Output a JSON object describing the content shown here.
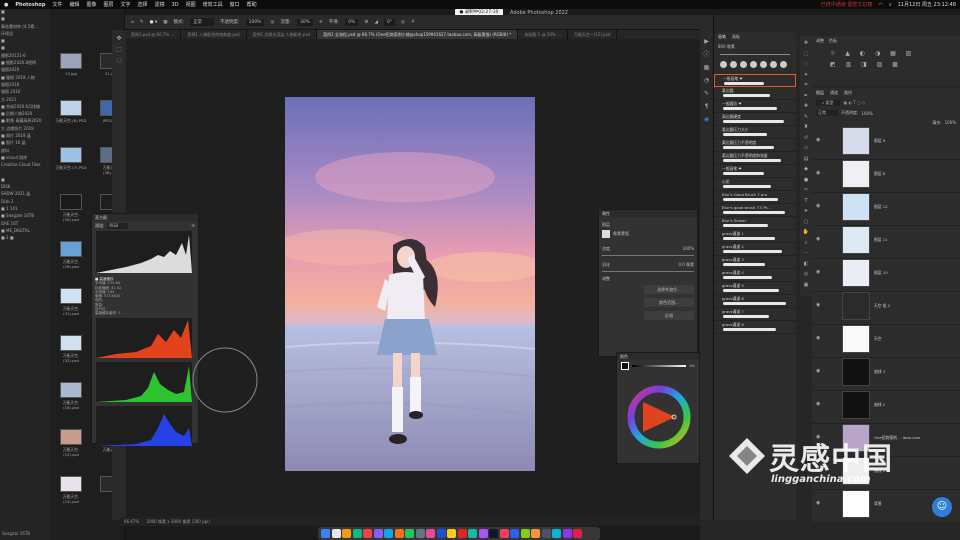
{
  "menubar": {
    "apple": "",
    "app": "Photoshop",
    "items": [
      "文件",
      "编辑",
      "图像",
      "图层",
      "文字",
      "选择",
      "滤镜",
      "3D",
      "视图",
      "增效工具",
      "窗口",
      "帮助"
    ],
    "status": "已修中通道 便签文幻丽",
    "datetime": "11月12日 周五 23:12:48"
  },
  "window": {
    "timer": "● 录制中02:27:30",
    "title": "Adobe Photoshop 2022"
  },
  "options": {
    "mode_label": "模式:",
    "mode_value": "正常",
    "opacity_label": "不透明度:",
    "opacity_value": "100%",
    "flow_label": "流量:",
    "flow_value": "30%",
    "smooth_label": "平滑:",
    "smooth_value": "0%",
    "angle_value": "0°"
  },
  "tabs": [
    "案例1.psd @ 66.7% ...",
    "案例1 人物配合的饱和度.psd",
    "案例1 边缘光渲染 人物配合.psd",
    "案例1 全流程.psd @ 66.7% (One招商案例小铺@shop159941627.taobao.com, 高级素描) (RGB/8) *",
    "未标题-1 @ 50% ...",
    "万能天空—(12).psd"
  ],
  "finder": {
    "sidebar": [
      "■",
      "■",
      "事务素材库 (4.5素...",
      "环境设",
      "■",
      "■",
      "摄影20121-6",
      "■ 摄影2020.8透明",
      "服图2020",
      "■ 服图 2018 人物",
      "服图2018",
      "服图 2016",
      "大 2021",
      "■ 合成2020.6月排输",
      "■ 后期人物2020",
      "■ 影像 青藏高原2020",
      "大 边缘照片 2019",
      "■ 照片 2018 晶",
      "■ 照片 16 晶",
      "度料",
      "■ icloud 照库",
      "Creative Cloud Files",
      "",
      "■",
      "DISK",
      "SHDW 2021 晶",
      "Disk 2",
      "■ 1 141",
      "■ Seagate 16TB",
      "GRE 16T",
      "■ ME_DIGITAL",
      "■ 2 ■"
    ],
    "files": [
      [
        "13.jpg",
        "21.jpg"
      ],
      [
        "万能天空-(8).PSD",
        "JPEG图片"
      ],
      [
        "万能天空-(7).PSD",
        "万能天空-(36).psd"
      ],
      [
        "万能天空-(30).psd",
        ""
      ],
      [
        "万能天空-(29).psd",
        "万能天空-"
      ],
      [
        "万能天空-(31).psd",
        "万能天空-"
      ],
      [
        "万能天空-(32).psd",
        "万能天空-"
      ],
      [
        "万能天空-(18).psd",
        "万能天空-"
      ],
      [
        "万能天空-(15).psd",
        "万能天空-"
      ],
      [
        "万能天空-(14).psd",
        ""
      ]
    ],
    "bottom": "Seagate 16TB"
  },
  "histogram": {
    "title": "直方图",
    "channel_label": "通道:",
    "channel_value": "RGB",
    "stats": [
      "平均值: 175.64",
      "标准偏差: 41.52",
      "中间值: 190",
      "像素: 5713400",
      "色阶:",
      "数量:",
      "百分位:",
      "高速缓存级别: 3"
    ],
    "tab": "■ 高速缓存"
  },
  "properties": {
    "title": "属性",
    "layer_label": "图层",
    "mask_label": "像素蒙版",
    "density_label": "浓度",
    "density_value": "100%",
    "feather_label": "羽化",
    "feather_value": "0.0 像素",
    "refine_label": "调整",
    "btn1": "选择并遮住...",
    "btn2": "颜色范围...",
    "btn3": "反相"
  },
  "color": {
    "title": "颜色",
    "value": "0%"
  },
  "brushes": {
    "tabs": [
      "画笔",
      "画板"
    ],
    "size": "800 像素",
    "presets": [
      "一般画笔 ❤",
      "柔边圆",
      "一般圆边 ❤",
      "高边圆硬度",
      "柔边圆压力大小",
      "柔边圆压力不透明度",
      "柔边圆压力不透明度和流量",
      "一般画笔 ❤",
      "火花",
      "Blur's Good Brush 7 pro",
      "Blur's good brush 7.0 Pr...",
      "Blur's Smear",
      "gravs通道 1",
      "gravs通道 2",
      "gravs通道 3",
      "gravs通道 4",
      "gravs通道 5",
      "gravs通道 6",
      "gravs通道 7",
      "gravs通道 8"
    ]
  },
  "navigator": {
    "tabs": [
      "调整",
      "色板"
    ]
  },
  "layers": {
    "tabs": [
      "图层",
      "通道",
      "路径"
    ],
    "blend": "正常",
    "opacity_label": "不透明度:",
    "opacity_value": "100%",
    "fill_label": "填充:",
    "fill_value": "100%",
    "items": [
      "图层 9",
      "图层 8",
      "图层 12",
      "图层 11",
      "图层 10",
      "天空 组 2",
      "天空",
      "曲线 3",
      "曲线 2",
      "One招商案例 ... ibao.com",
      "曲线 1",
      "背景"
    ]
  },
  "status": {
    "zoom": "66.67%",
    "doc": "2000 像素 x 3000 像素 (300 ppi)"
  },
  "watermark": {
    "cn": "灵感中国",
    "en": "lingganchina.com"
  },
  "colors": {
    "accent": "#2f7ed8",
    "orange": "#e85b20"
  }
}
